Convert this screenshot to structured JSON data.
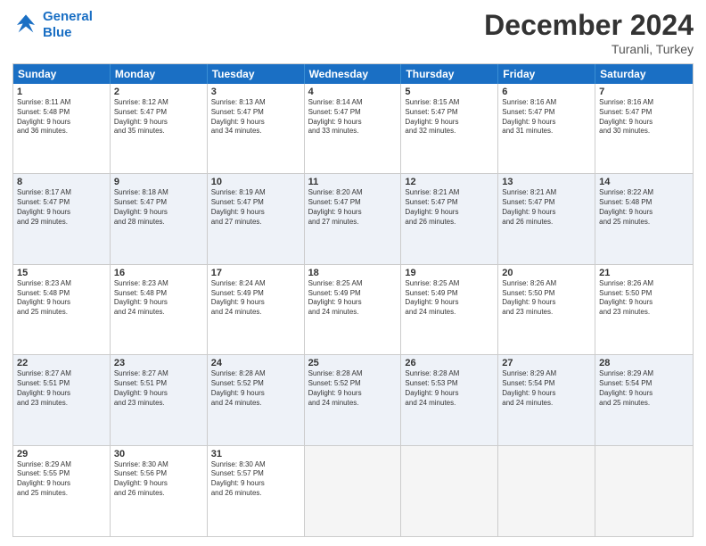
{
  "logo": {
    "line1": "General",
    "line2": "Blue"
  },
  "title": "December 2024",
  "location": "Turanli, Turkey",
  "header_days": [
    "Sunday",
    "Monday",
    "Tuesday",
    "Wednesday",
    "Thursday",
    "Friday",
    "Saturday"
  ],
  "rows": [
    [
      {
        "day": "1",
        "text": "Sunrise: 8:11 AM\nSunset: 5:48 PM\nDaylight: 9 hours\nand 36 minutes."
      },
      {
        "day": "2",
        "text": "Sunrise: 8:12 AM\nSunset: 5:47 PM\nDaylight: 9 hours\nand 35 minutes."
      },
      {
        "day": "3",
        "text": "Sunrise: 8:13 AM\nSunset: 5:47 PM\nDaylight: 9 hours\nand 34 minutes."
      },
      {
        "day": "4",
        "text": "Sunrise: 8:14 AM\nSunset: 5:47 PM\nDaylight: 9 hours\nand 33 minutes."
      },
      {
        "day": "5",
        "text": "Sunrise: 8:15 AM\nSunset: 5:47 PM\nDaylight: 9 hours\nand 32 minutes."
      },
      {
        "day": "6",
        "text": "Sunrise: 8:16 AM\nSunset: 5:47 PM\nDaylight: 9 hours\nand 31 minutes."
      },
      {
        "day": "7",
        "text": "Sunrise: 8:16 AM\nSunset: 5:47 PM\nDaylight: 9 hours\nand 30 minutes."
      }
    ],
    [
      {
        "day": "8",
        "text": "Sunrise: 8:17 AM\nSunset: 5:47 PM\nDaylight: 9 hours\nand 29 minutes."
      },
      {
        "day": "9",
        "text": "Sunrise: 8:18 AM\nSunset: 5:47 PM\nDaylight: 9 hours\nand 28 minutes."
      },
      {
        "day": "10",
        "text": "Sunrise: 8:19 AM\nSunset: 5:47 PM\nDaylight: 9 hours\nand 27 minutes."
      },
      {
        "day": "11",
        "text": "Sunrise: 8:20 AM\nSunset: 5:47 PM\nDaylight: 9 hours\nand 27 minutes."
      },
      {
        "day": "12",
        "text": "Sunrise: 8:21 AM\nSunset: 5:47 PM\nDaylight: 9 hours\nand 26 minutes."
      },
      {
        "day": "13",
        "text": "Sunrise: 8:21 AM\nSunset: 5:47 PM\nDaylight: 9 hours\nand 26 minutes."
      },
      {
        "day": "14",
        "text": "Sunrise: 8:22 AM\nSunset: 5:48 PM\nDaylight: 9 hours\nand 25 minutes."
      }
    ],
    [
      {
        "day": "15",
        "text": "Sunrise: 8:23 AM\nSunset: 5:48 PM\nDaylight: 9 hours\nand 25 minutes."
      },
      {
        "day": "16",
        "text": "Sunrise: 8:23 AM\nSunset: 5:48 PM\nDaylight: 9 hours\nand 24 minutes."
      },
      {
        "day": "17",
        "text": "Sunrise: 8:24 AM\nSunset: 5:49 PM\nDaylight: 9 hours\nand 24 minutes."
      },
      {
        "day": "18",
        "text": "Sunrise: 8:25 AM\nSunset: 5:49 PM\nDaylight: 9 hours\nand 24 minutes."
      },
      {
        "day": "19",
        "text": "Sunrise: 8:25 AM\nSunset: 5:49 PM\nDaylight: 9 hours\nand 24 minutes."
      },
      {
        "day": "20",
        "text": "Sunrise: 8:26 AM\nSunset: 5:50 PM\nDaylight: 9 hours\nand 23 minutes."
      },
      {
        "day": "21",
        "text": "Sunrise: 8:26 AM\nSunset: 5:50 PM\nDaylight: 9 hours\nand 23 minutes."
      }
    ],
    [
      {
        "day": "22",
        "text": "Sunrise: 8:27 AM\nSunset: 5:51 PM\nDaylight: 9 hours\nand 23 minutes."
      },
      {
        "day": "23",
        "text": "Sunrise: 8:27 AM\nSunset: 5:51 PM\nDaylight: 9 hours\nand 23 minutes."
      },
      {
        "day": "24",
        "text": "Sunrise: 8:28 AM\nSunset: 5:52 PM\nDaylight: 9 hours\nand 24 minutes."
      },
      {
        "day": "25",
        "text": "Sunrise: 8:28 AM\nSunset: 5:52 PM\nDaylight: 9 hours\nand 24 minutes."
      },
      {
        "day": "26",
        "text": "Sunrise: 8:28 AM\nSunset: 5:53 PM\nDaylight: 9 hours\nand 24 minutes."
      },
      {
        "day": "27",
        "text": "Sunrise: 8:29 AM\nSunset: 5:54 PM\nDaylight: 9 hours\nand 24 minutes."
      },
      {
        "day": "28",
        "text": "Sunrise: 8:29 AM\nSunset: 5:54 PM\nDaylight: 9 hours\nand 25 minutes."
      }
    ],
    [
      {
        "day": "29",
        "text": "Sunrise: 8:29 AM\nSunset: 5:55 PM\nDaylight: 9 hours\nand 25 minutes."
      },
      {
        "day": "30",
        "text": "Sunrise: 8:30 AM\nSunset: 5:56 PM\nDaylight: 9 hours\nand 26 minutes."
      },
      {
        "day": "31",
        "text": "Sunrise: 8:30 AM\nSunset: 5:57 PM\nDaylight: 9 hours\nand 26 minutes."
      },
      {
        "day": "",
        "text": ""
      },
      {
        "day": "",
        "text": ""
      },
      {
        "day": "",
        "text": ""
      },
      {
        "day": "",
        "text": ""
      }
    ]
  ]
}
